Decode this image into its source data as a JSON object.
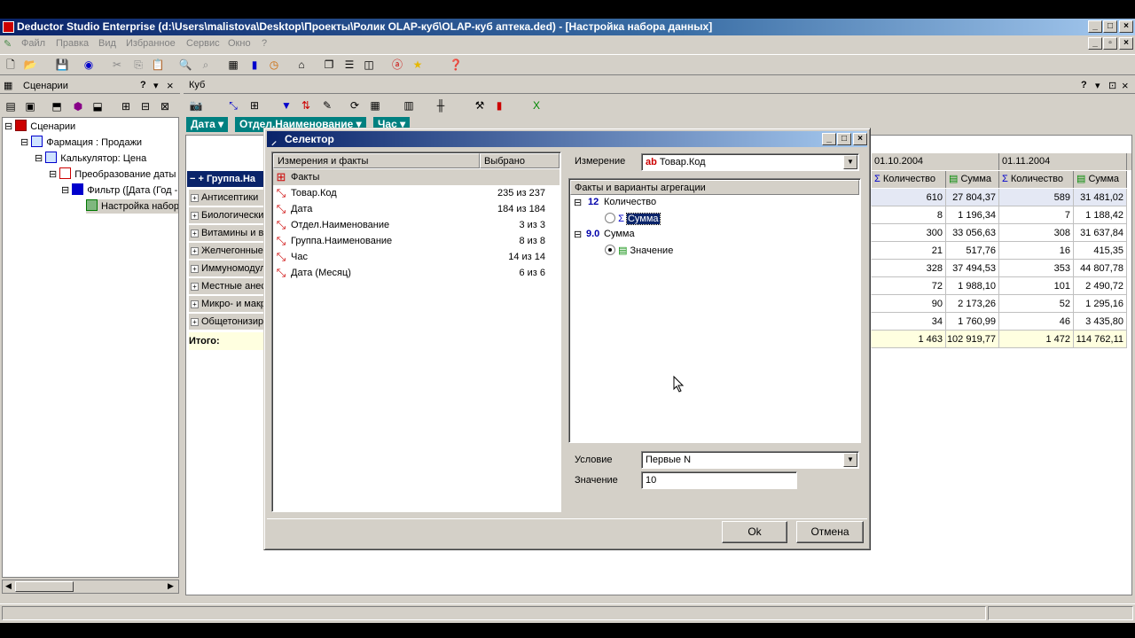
{
  "window": {
    "title": "Deductor Studio Enterprise (d:\\Users\\malistova\\Desktop\\Проекты\\Ролик OLAP-куб\\OLAP-куб аптека.ded) - [Настройка набора данных]"
  },
  "menu": [
    "Файл",
    "Правка",
    "Вид",
    "Избранное",
    "Сервис",
    "Окно",
    "?"
  ],
  "left_pane": {
    "title": "Сценарии",
    "tree": [
      "Сценарии",
      "Фармация : Продажи",
      "Калькулятор: Цена",
      "Преобразование даты [",
      "Фильтр ([Дата (Год -",
      "Настройка набор"
    ]
  },
  "right_pane": {
    "title": "Куб",
    "dims": [
      "Дата",
      "Отдел.Наименование",
      "Час"
    ],
    "group_header": "Группа.На",
    "rows": [
      "Антисептики",
      "Биологически",
      "Витамины и ви",
      "Желчегонные",
      "Иммуномодуля",
      "Местные анес",
      "Микро- и макр",
      "Общетонизир"
    ],
    "total_label": "Итого:",
    "months": [
      "01.10.2004",
      "01.11.2004"
    ],
    "col_qty": "Количество",
    "col_sum": "Сумма",
    "values": [
      [
        "610",
        "27 804,37",
        "589",
        "31 481,02"
      ],
      [
        "8",
        "1 196,34",
        "7",
        "1 188,42"
      ],
      [
        "300",
        "33 056,63",
        "308",
        "31 637,84"
      ],
      [
        "21",
        "517,76",
        "16",
        "415,35"
      ],
      [
        "328",
        "37 494,53",
        "353",
        "44 807,78"
      ],
      [
        "72",
        "1 988,10",
        "101",
        "2 490,72"
      ],
      [
        "90",
        "2 173,26",
        "52",
        "1 295,16"
      ],
      [
        "34",
        "1 760,99",
        "46",
        "3 435,80"
      ]
    ],
    "totals": [
      "1 463",
      "102 919,77",
      "1 472",
      "114 762,11"
    ]
  },
  "dialog": {
    "title": "Селектор",
    "list_headers": [
      "Измерения и факты",
      "Выбрано"
    ],
    "list": [
      {
        "name": "Факты",
        "sel": ""
      },
      {
        "name": "Товар.Код",
        "sel": "235 из 237"
      },
      {
        "name": "Дата",
        "sel": "184 из 184"
      },
      {
        "name": "Отдел.Наименование",
        "sel": "3 из 3"
      },
      {
        "name": "Группа.Наименование",
        "sel": "8 из 8"
      },
      {
        "name": "Час",
        "sel": "14 из 14"
      },
      {
        "name": "Дата (Месяц)",
        "sel": "6 из 6"
      }
    ],
    "dimension_label": "Измерение",
    "dimension_value": "Товар.Код",
    "facts_header": "Факты и варианты агрегации",
    "fact1_type": "12",
    "fact1_name": "Количество",
    "fact1_agg": "Сумма",
    "fact2_type": "9.0",
    "fact2_name": "Сумма",
    "fact2_agg": "Значение",
    "condition_label": "Условие",
    "condition_value": "Первые N",
    "value_label": "Значение",
    "value_value": "10",
    "ok": "Ok",
    "cancel": "Отмена"
  }
}
